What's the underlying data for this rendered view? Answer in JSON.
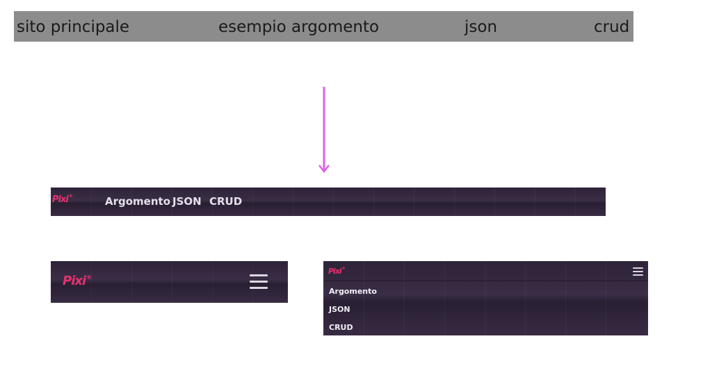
{
  "plain_nav": {
    "items": [
      {
        "label": "sito principale"
      },
      {
        "label": "esempio argomento"
      },
      {
        "label": "json"
      },
      {
        "label": "crud"
      }
    ],
    "background": "#8c8c8c"
  },
  "arrow": {
    "color": "#e060e8",
    "direction": "down"
  },
  "themed_nav": {
    "logo": "Pixi",
    "logo_mark": "®",
    "background": "#342740",
    "logo_color": "#e8306e",
    "desktop_links": [
      {
        "label": "Argomento"
      },
      {
        "label": "JSON"
      },
      {
        "label": "CRUD"
      }
    ],
    "menu_icon": "hamburger-icon",
    "mobile_menu_items": [
      {
        "label": "Argomento"
      },
      {
        "label": "JSON"
      },
      {
        "label": "CRUD"
      }
    ]
  }
}
